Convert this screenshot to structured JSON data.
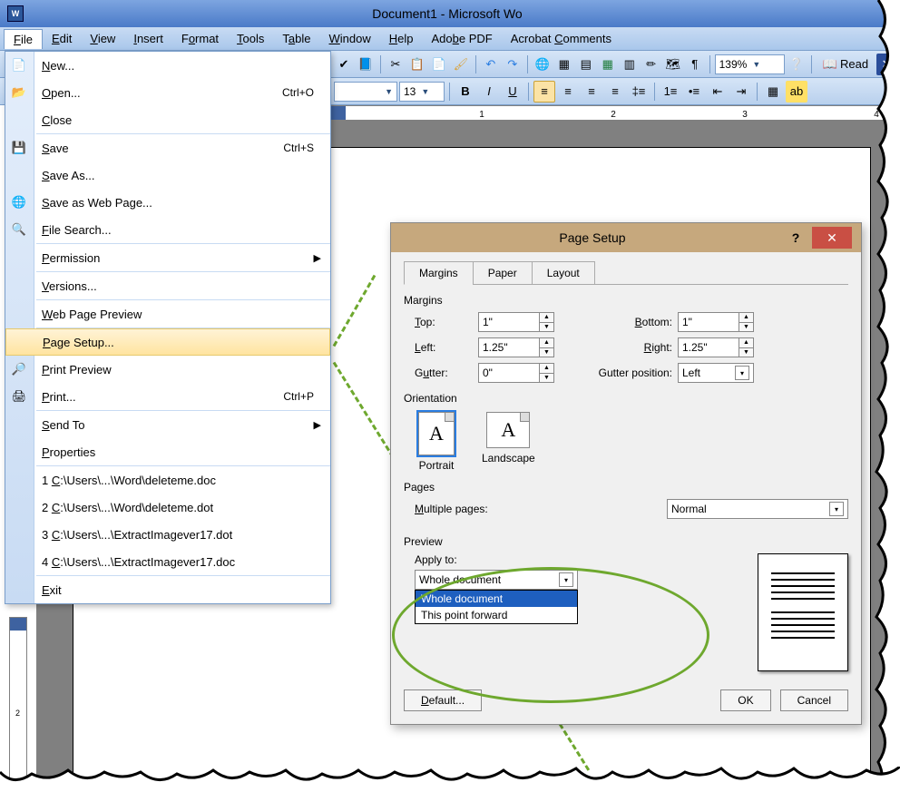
{
  "title": "Document1 - Microsoft Wo",
  "menus": [
    "File",
    "Edit",
    "View",
    "Insert",
    "Format",
    "Tools",
    "Table",
    "Window",
    "Help",
    "Adobe PDF",
    "Acrobat Comments"
  ],
  "toolbar2": {
    "fontsize": "13",
    "zoom": "139%",
    "read": "Read"
  },
  "ruler": {
    "ticks": [
      "1",
      "2",
      "3",
      "4"
    ]
  },
  "file_menu": {
    "items": [
      {
        "label": "New...",
        "icon": "📄"
      },
      {
        "label": "Open...",
        "shortcut": "Ctrl+O",
        "icon": "📂"
      },
      {
        "label": "Close"
      },
      {
        "sep": true
      },
      {
        "label": "Save",
        "shortcut": "Ctrl+S",
        "icon": "💾"
      },
      {
        "label": "Save As..."
      },
      {
        "label": "Save as Web Page...",
        "icon": "🌐"
      },
      {
        "label": "File Search...",
        "icon": "🔍"
      },
      {
        "sep": true
      },
      {
        "label": "Permission",
        "submenu": true
      },
      {
        "sep": true
      },
      {
        "label": "Versions..."
      },
      {
        "sep": true
      },
      {
        "label": "Web Page Preview"
      },
      {
        "sep": true
      },
      {
        "label": "Page Setup...",
        "highlight": true
      },
      {
        "label": "Print Preview",
        "icon": "🔎"
      },
      {
        "label": "Print...",
        "shortcut": "Ctrl+P",
        "icon": "🖨"
      },
      {
        "sep": true
      },
      {
        "label": "Send To",
        "submenu": true
      },
      {
        "label": "Properties"
      },
      {
        "sep": true
      },
      {
        "label": "1 C:\\Users\\...\\Word\\deleteme.doc"
      },
      {
        "label": "2 C:\\Users\\...\\Word\\deleteme.dot"
      },
      {
        "label": "3 C:\\Users\\...\\ExtractImagever17.dot"
      },
      {
        "label": "4 C:\\Users\\...\\ExtractImagever17.doc"
      },
      {
        "sep": true
      },
      {
        "label": "Exit"
      }
    ]
  },
  "dialog": {
    "title": "Page Setup",
    "tabs": [
      "Margins",
      "Paper",
      "Layout"
    ],
    "active_tab": "Margins",
    "margins": {
      "top_label": "Top:",
      "top": "1\"",
      "bottom_label": "Bottom:",
      "bottom": "1\"",
      "left_label": "Left:",
      "left": "1.25\"",
      "right_label": "Right:",
      "right": "1.25\"",
      "gutter_label": "Gutter:",
      "gutter": "0\"",
      "gutter_pos_label": "Gutter position:",
      "gutter_pos": "Left"
    },
    "orientation": {
      "label": "Orientation",
      "portrait": "Portrait",
      "landscape": "Landscape",
      "selected": "Portrait"
    },
    "pages": {
      "label": "Pages",
      "multi_label": "Multiple pages:",
      "value": "Normal"
    },
    "preview": {
      "label": "Preview",
      "apply_label": "Apply to:",
      "value": "Whole document",
      "options": [
        "Whole document",
        "This point forward"
      ]
    },
    "buttons": {
      "default": "Default...",
      "ok": "OK",
      "cancel": "Cancel"
    }
  }
}
